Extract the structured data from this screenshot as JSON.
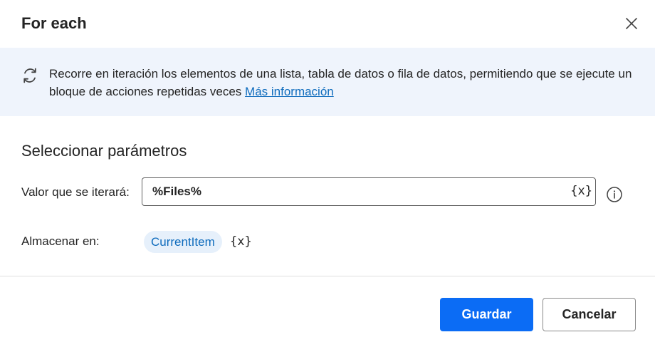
{
  "dialog": {
    "title": "For each",
    "close_icon": "close-icon"
  },
  "banner": {
    "icon": "loop-icon",
    "text": "Recorre en iteración los elementos de una lista, tabla de datos o fila de datos, permitiendo que se ejecute un bloque de acciones repetidas veces",
    "link_text": "Más información"
  },
  "parameters": {
    "section_title": "Seleccionar parámetros",
    "iterate": {
      "label": "Valor que se iterará:",
      "value": "%Files%",
      "var_button": "{x}",
      "info_icon": "info-icon"
    },
    "store": {
      "label": "Almacenar en:",
      "variable": "CurrentItem",
      "var_button": "{x}"
    }
  },
  "footer": {
    "save_label": "Guardar",
    "cancel_label": "Cancelar"
  },
  "colors": {
    "accent": "#0b6cf5",
    "link": "#0f6cbd",
    "banner_bg": "#eff4fc",
    "chip_bg": "#e6f0fb"
  }
}
